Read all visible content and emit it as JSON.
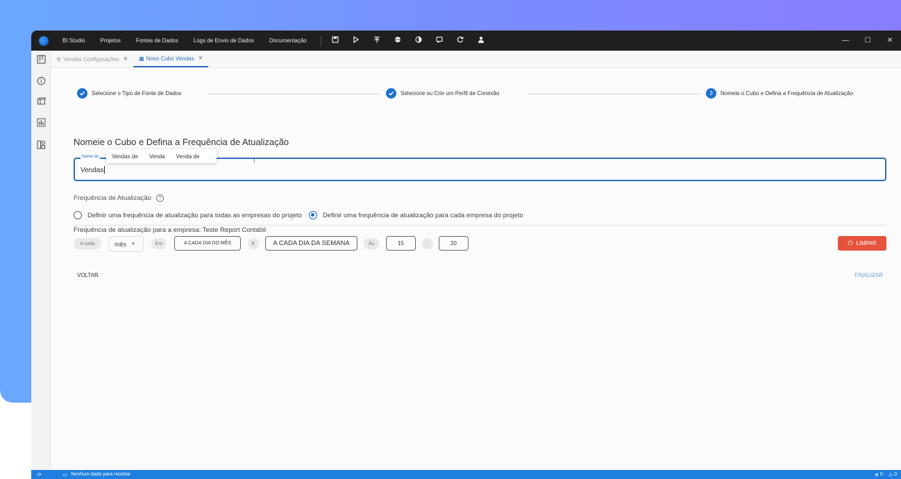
{
  "menu": [
    "BI Studio",
    "Projetos",
    "Fontes de Dados",
    "Logs de Envio de Dados",
    "Documentação"
  ],
  "toolbar_icons": [
    "save-icon",
    "run-icon",
    "publish-icon",
    "globe-icon",
    "contrast-icon",
    "chat-icon",
    "refresh-icon",
    "user-icon"
  ],
  "window_controls": {
    "minimize": "—",
    "maximize": "☐",
    "close": "✕"
  },
  "sidebar_icons": [
    "board-icon",
    "info-icon",
    "cube-icon",
    "bar-chart-icon",
    "dashboard-icon"
  ],
  "tabs": [
    {
      "label": "Vendas Configurações",
      "active": false
    },
    {
      "label": "Novo Cubo Vendas",
      "active": true
    }
  ],
  "steps": [
    {
      "label": "Selecione o Tipo de Fonte de Dados",
      "status": "done"
    },
    {
      "label": "Selecione ou Crie um Perfil de Conexão",
      "status": "done"
    },
    {
      "label": "Nomeie o Cubo e Defina a Frequência de Atualização",
      "status": "current",
      "number": "3"
    }
  ],
  "heading": "Nomeie o Cubo e Defina a Frequência de Atualização",
  "name_field": {
    "label": "Nome do",
    "value": "Vendas"
  },
  "autocomplete": [
    "Vendas de",
    "Venda",
    "Venda de"
  ],
  "frequency": {
    "label": "Frequência de Atualização",
    "help": "?",
    "options": [
      {
        "label": "Definir uma frequência de atualização para todas as empresas do projeto",
        "checked": false
      },
      {
        "label": "Definir uma frequência de atualização para cada empresa do projeto",
        "checked": true
      }
    ],
    "company_line": "Frequência de atualização para a empresa: Teste Report Contábil"
  },
  "schedule": {
    "a_cada": "A cada",
    "period": "mês",
    "em": "Em",
    "day_of_month": "A CADA DIA DO MÊS",
    "e": "E",
    "day_of_week": "A CADA DIA DA SEMANA",
    "as": "Às",
    "hour": "15",
    "colon": ":",
    "minute": "20"
  },
  "buttons": {
    "limpar": "LIMPAR",
    "voltar": "VOLTAR",
    "finalizar": "FINALIZAR"
  },
  "statusbar": {
    "message": "Nenhum dado para mostrar",
    "errors": "0",
    "warnings": "0"
  },
  "colors": {
    "accent": "#1e6fcc",
    "danger": "#e5533d",
    "statusbar": "#1e7fe0",
    "titlebar": "#1f1f1f"
  }
}
